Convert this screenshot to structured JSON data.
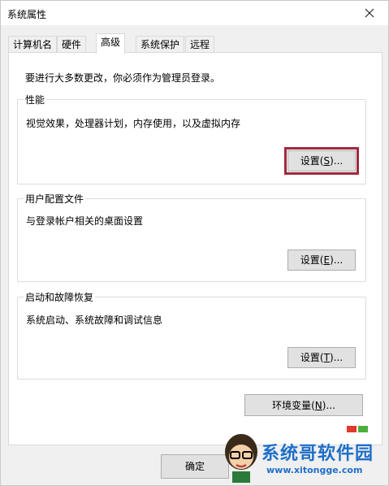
{
  "window": {
    "title": "系统属性"
  },
  "tabs": [
    {
      "label": "计算机名"
    },
    {
      "label": "硬件"
    },
    {
      "label": "高级"
    },
    {
      "label": "系统保护"
    },
    {
      "label": "远程"
    }
  ],
  "active_tab": "高级",
  "intro": "要进行大多数更改，你必须作为管理员登录。",
  "performance": {
    "title": "性能",
    "desc": "视觉效果，处理器计划，内存使用，以及虚拟内存",
    "button_pre": "设置(",
    "button_key": "S",
    "button_post": ")..."
  },
  "user_profiles": {
    "title": "用户配置文件",
    "desc": "与登录帐户相关的桌面设置",
    "button_pre": "设置(",
    "button_key": "E",
    "button_post": ")..."
  },
  "startup": {
    "title": "启动和故障恢复",
    "desc": "系统启动、系统故障和调试信息",
    "button_pre": "设置(",
    "button_key": "T",
    "button_post": ")..."
  },
  "env_button": {
    "pre": "环境变量(",
    "key": "N",
    "post": ")..."
  },
  "ok_button": "确定",
  "watermark": {
    "text": "系统哥软件园",
    "url": "www.xitongge.com"
  },
  "colors": {
    "highlight": "#a0283c",
    "watermark": "#1e6fc8"
  },
  "icons": {
    "close": "close-icon"
  }
}
